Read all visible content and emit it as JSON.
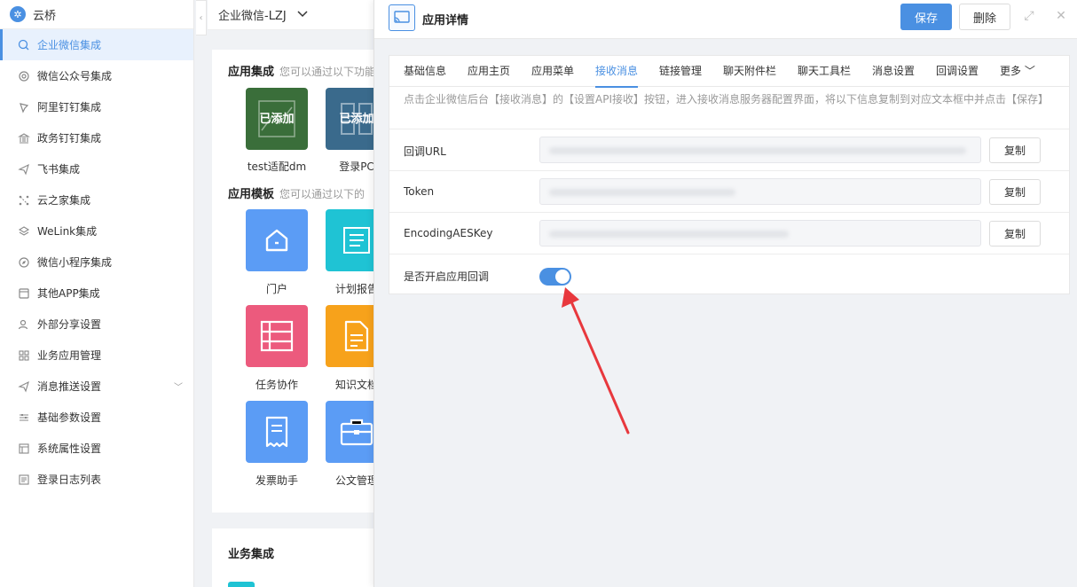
{
  "brand": {
    "name": "云桥",
    "logo_icon": "cloud-bridge-icon"
  },
  "sidebar": {
    "items": [
      {
        "label": "企业微信集成",
        "icon": "chat-icon",
        "active": true
      },
      {
        "label": "微信公众号集成",
        "icon": "gear-icon"
      },
      {
        "label": "阿里钉钉集成",
        "icon": "pin-icon"
      },
      {
        "label": "政务钉钉集成",
        "icon": "bank-icon"
      },
      {
        "label": "飞书集成",
        "icon": "plane-icon"
      },
      {
        "label": "云之家集成",
        "icon": "network-icon"
      },
      {
        "label": "WeLink集成",
        "icon": "layers-icon"
      },
      {
        "label": "微信小程序集成",
        "icon": "compass-icon"
      },
      {
        "label": "其他APP集成",
        "icon": "app-icon"
      },
      {
        "label": "外部分享设置",
        "icon": "user-icon"
      },
      {
        "label": "业务应用管理",
        "icon": "grid-icon"
      },
      {
        "label": "消息推送设置",
        "icon": "send-icon",
        "has_submenu": true
      },
      {
        "label": "基础参数设置",
        "icon": "sliders-icon"
      },
      {
        "label": "系统属性设置",
        "icon": "window-icon"
      },
      {
        "label": "登录日志列表",
        "icon": "log-icon"
      }
    ]
  },
  "topbar": {
    "corp_name": "企业微信-LZJ"
  },
  "app_integration": {
    "title": "应用集成",
    "hint": "您可以通过以下功能",
    "apps": [
      {
        "label": "test适配dm",
        "badge": "已添加",
        "color": "#3a6e3a"
      },
      {
        "label": "登录PC",
        "badge": "已添加",
        "color": "#3a6a8c"
      }
    ]
  },
  "app_templates": {
    "title": "应用模板",
    "hint": "您可以通过以下的",
    "items": [
      {
        "label": "门户",
        "color": "#5b9cf5",
        "icon": "home-icon"
      },
      {
        "label": "计划报告",
        "color": "#1fc3d4",
        "icon": "report-icon"
      },
      {
        "label": "任务协作",
        "color": "#ec5a7d",
        "icon": "list-icon"
      },
      {
        "label": "知识文档",
        "color": "#f7a21b",
        "icon": "document-icon"
      },
      {
        "label": "发票助手",
        "color": "#5b9cf5",
        "icon": "receipt-icon"
      },
      {
        "label": "公文管理",
        "color": "#5b9cf5",
        "icon": "briefcase-icon"
      }
    ]
  },
  "business": {
    "title": "业务集成"
  },
  "panel": {
    "title": "应用详情",
    "save_label": "保存",
    "delete_label": "删除",
    "tabs": [
      "基础信息",
      "应用主页",
      "应用菜单",
      "接收消息",
      "链接管理",
      "聊天附件栏",
      "聊天工具栏",
      "消息设置",
      "回调设置",
      "更多"
    ],
    "active_tab": "接收消息",
    "notice": "点击企业微信后台【接收消息】的【设置API接收】按钮，进入接收消息服务器配置界面，将以下信息复制到对应文本框中并点击【保存】",
    "fields": [
      {
        "label": "回调URL",
        "copy_label": "复制"
      },
      {
        "label": "Token",
        "copy_label": "复制"
      },
      {
        "label": "EncodingAESKey",
        "copy_label": "复制"
      }
    ],
    "callback_toggle": {
      "label": "是否开启应用回调",
      "enabled": true
    },
    "annotation_color": "#e8383d"
  }
}
